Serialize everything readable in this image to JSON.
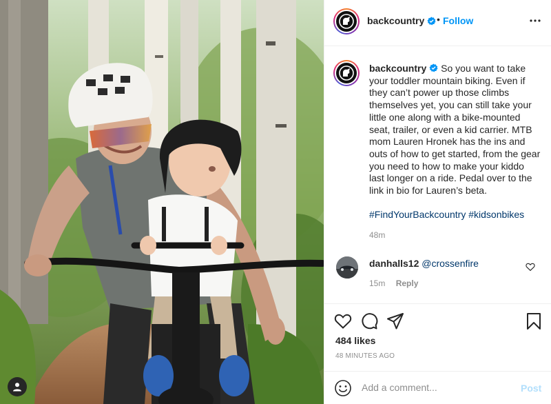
{
  "header": {
    "username": "backcountry",
    "separator": "•",
    "follow_label": "Follow",
    "more_icon": "more-horizontal-icon"
  },
  "caption": {
    "username": "backcountry",
    "text": "So you want to take your toddler mountain biking. Even if they can’t power up those climbs themselves yet, you can still take your little one along with a bike-mounted seat, trailer, or even a kid carrier. MTB mom Lauren Hronek has the ins and outs of how to get started, from the gear you need to how to make your kiddo last longer on a ride. Pedal over to the link in bio for Lauren’s beta.",
    "hashtags": "#FindYourBackcountry #kidsonbikes",
    "time": "48m"
  },
  "comment": {
    "username": "danhalls12",
    "mention": "@crossenfire",
    "time": "15m",
    "reply_label": "Reply"
  },
  "stats": {
    "likes": "484 likes",
    "posted_ago": "48 MINUTES AGO"
  },
  "comment_box": {
    "placeholder": "Add a comment...",
    "post_label": "Post"
  },
  "colors": {
    "accent": "#0095f6",
    "link": "#00376b",
    "muted": "#8e8e8e",
    "post_disabled": "#b2dffc"
  }
}
